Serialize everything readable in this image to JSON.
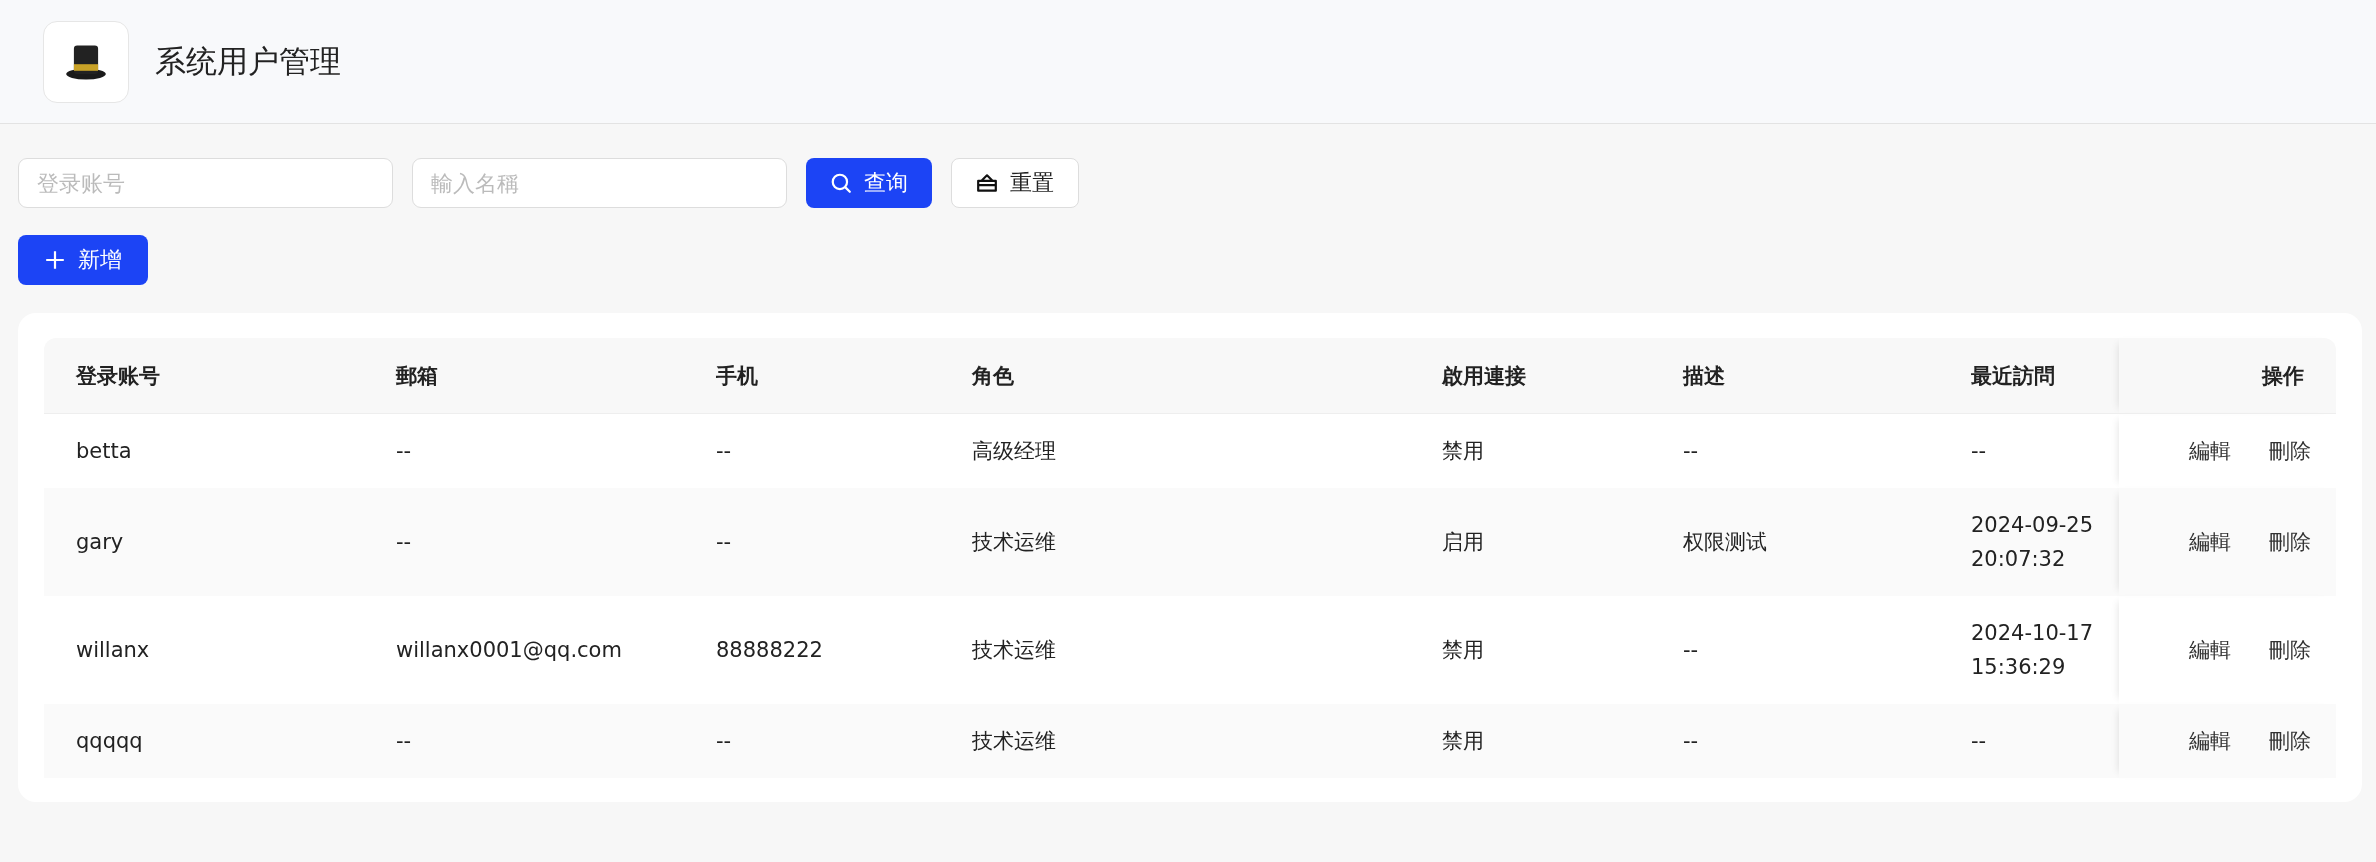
{
  "header": {
    "title": "系统用户管理"
  },
  "filters": {
    "account": {
      "placeholder": "登录账号"
    },
    "name": {
      "placeholder": "輸入名稱"
    },
    "search_button": "查询",
    "reset_button": "重置"
  },
  "add_button": "新增",
  "table": {
    "columns": [
      "登录账号",
      "郵箱",
      "手机",
      "角色",
      "啟用連接",
      "描述",
      "最近訪問",
      "操作"
    ],
    "rows": [
      {
        "cells": [
          "betta",
          "--",
          "--",
          "高级经理",
          "禁用",
          "--",
          "--"
        ],
        "actions": [
          "編輯",
          "刪除"
        ]
      },
      {
        "cells": [
          "gary",
          "--",
          "--",
          "技术运维",
          "启用",
          "权限测试",
          "2024-09-25 20:07:32"
        ],
        "actions": [
          "編輯",
          "刪除"
        ]
      },
      {
        "cells": [
          "willanx",
          "willanx0001@qq.com",
          "88888222",
          "技术运维",
          "禁用",
          "--",
          "2024-10-17 15:36:29"
        ],
        "actions": [
          "編輯",
          "刪除"
        ]
      },
      {
        "cells": [
          "qqqqq",
          "--",
          "--",
          "技术运维",
          "禁用",
          "--",
          "--"
        ],
        "actions": [
          "編輯",
          "刪除"
        ]
      }
    ]
  }
}
